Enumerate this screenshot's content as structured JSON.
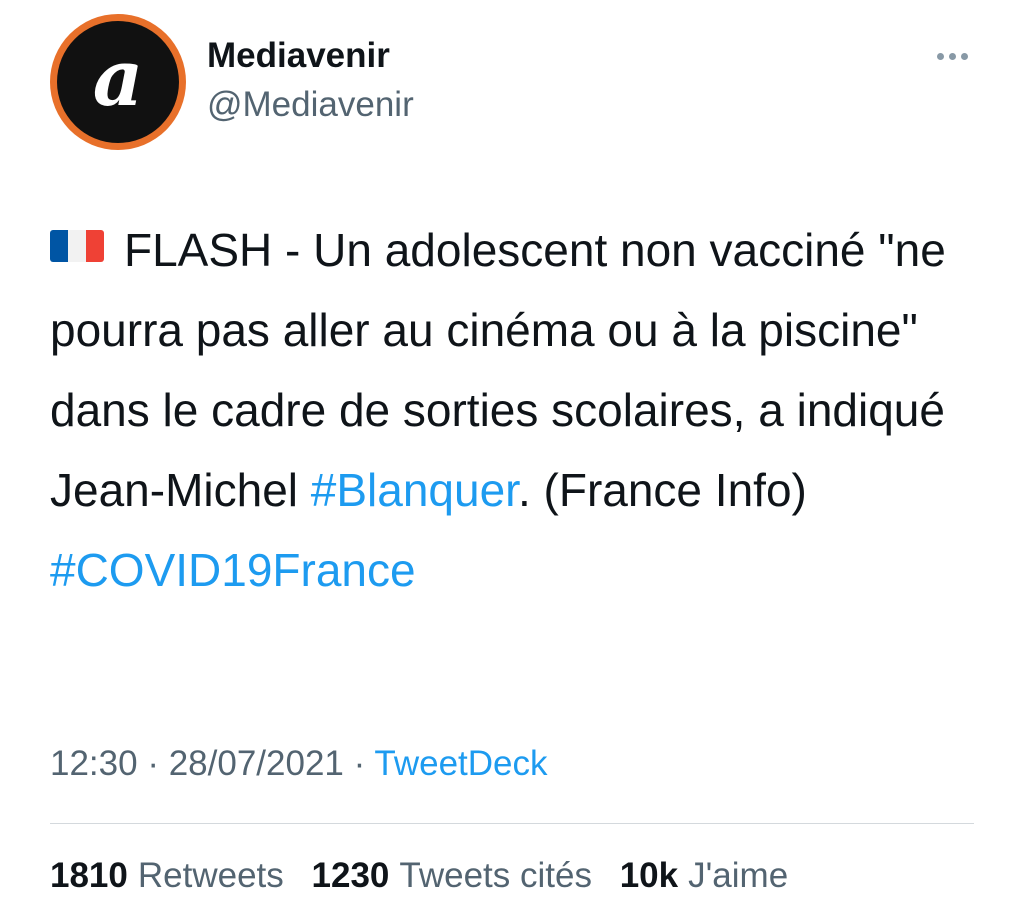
{
  "tweet": {
    "author": {
      "display_name": "Mediavenir",
      "handle": "@Mediavenir",
      "avatar_letter": "a",
      "avatar_border_color": "#e8702a"
    },
    "more_icon": "more-options-icon",
    "flag_icon": "france-flag-emoji",
    "text": {
      "line_prefix": "FLASH - Un adolescent non vacciné \"ne pourra pas aller au cinéma ou à la piscine\" dans le cadre de sorties scolaires, a indiqué Jean-Michel ",
      "hashtag_1": "#Blanquer",
      "middle": ". (France Info) ",
      "hashtag_2": "#COVID19France"
    },
    "time": "12:30",
    "separator": "·",
    "date": "28/07/2021",
    "source": "TweetDeck",
    "stats": {
      "retweets_count": "1810",
      "retweets_label": "Retweets",
      "quotes_count": "1230",
      "quotes_label": "Tweets cités",
      "likes_count": "10k",
      "likes_label": "J'aime"
    },
    "colors": {
      "link": "#1d9bf0",
      "secondary_text": "#536471",
      "primary_text": "#0f1419"
    }
  }
}
